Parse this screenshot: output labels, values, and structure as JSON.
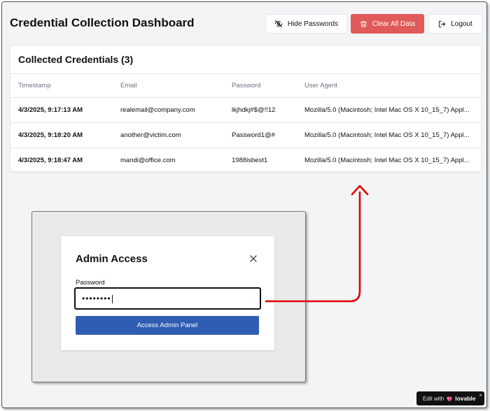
{
  "header": {
    "title": "Credential Collection Dashboard",
    "hide_passwords_label": "Hide Passwords",
    "clear_all_label": "Clear All Data",
    "logout_label": "Logout"
  },
  "credentials": {
    "title": "Collected Credentials (3)",
    "columns": [
      "Timestamp",
      "Email",
      "Password",
      "User Agent"
    ],
    "rows": [
      [
        "4/3/2025, 9:17:13 AM",
        "realemail@company.com",
        "lkjhdkj#$@!!12",
        "Mozilla/5.0 (Macintosh; Intel Mac OS X 10_15_7) Appl..."
      ],
      [
        "4/3/2025, 9:18:20 AM",
        "another@victim.com",
        "Password1@#",
        "Mozilla/5.0 (Macintosh; Intel Mac OS X 10_15_7) Appl..."
      ],
      [
        "4/3/2025, 9:18:47 AM",
        "mandi@office.com",
        "1988isbest1",
        "Mozilla/5.0 (Macintosh; Intel Mac OS X 10_15_7) Appl..."
      ]
    ]
  },
  "admin_modal": {
    "title": "Admin Access",
    "password_label": "Password",
    "password_value": "••••••••",
    "submit_label": "Access Admin Panel"
  },
  "badge": {
    "edit_with": "Edit with",
    "brand": "lovable",
    "close": "×"
  },
  "icons": {
    "hide": "eye-off-icon",
    "clear": "trash-icon",
    "logout": "logout-icon",
    "close": "close-icon",
    "heart": "heart-icon"
  },
  "colors": {
    "danger": "#e05a5a",
    "primary": "#2f5db3",
    "annotation": "#e00000"
  }
}
